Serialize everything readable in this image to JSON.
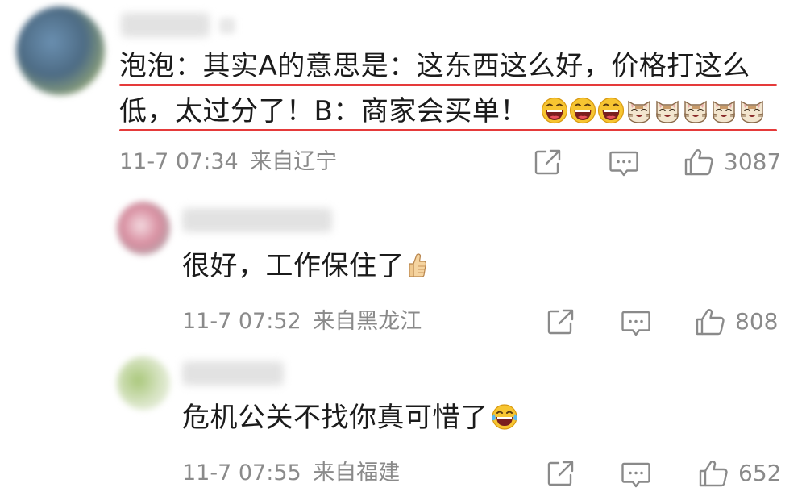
{
  "comments": [
    {
      "lines": [
        "泡泡：其实A的意思是：这东西这么好，价格打这么",
        "低，太过分了！B：商家会买单！"
      ],
      "time": "11-7 07:34",
      "location": "来自辽宁",
      "likes": "3087",
      "trailing_emoji": [
        "laugh-icon",
        "laugh-icon",
        "laugh-icon",
        "cat-icon",
        "cat-icon",
        "cat-icon",
        "cat-icon",
        "cat-icon"
      ],
      "highlight_color": "#e53a3a"
    },
    {
      "lines": [
        "很好，工作保住了"
      ],
      "time": "11-7 07:52",
      "location": "来自黑龙江",
      "likes": "808",
      "trailing_emoji": [
        "thumbs-up-icon"
      ]
    },
    {
      "lines": [
        "危机公关不找你真可惜了"
      ],
      "time": "11-7 07:55",
      "location": "来自福建",
      "likes": "652",
      "trailing_emoji": [
        "tears-of-joy-icon"
      ]
    }
  ],
  "icons": {
    "share": "share-icon",
    "reply": "comment-icon",
    "like": "thumbs-up-outline-icon"
  },
  "colors": {
    "text": "#1b1b1b",
    "meta": "#8a8a8a",
    "highlight": "#e53a3a"
  }
}
